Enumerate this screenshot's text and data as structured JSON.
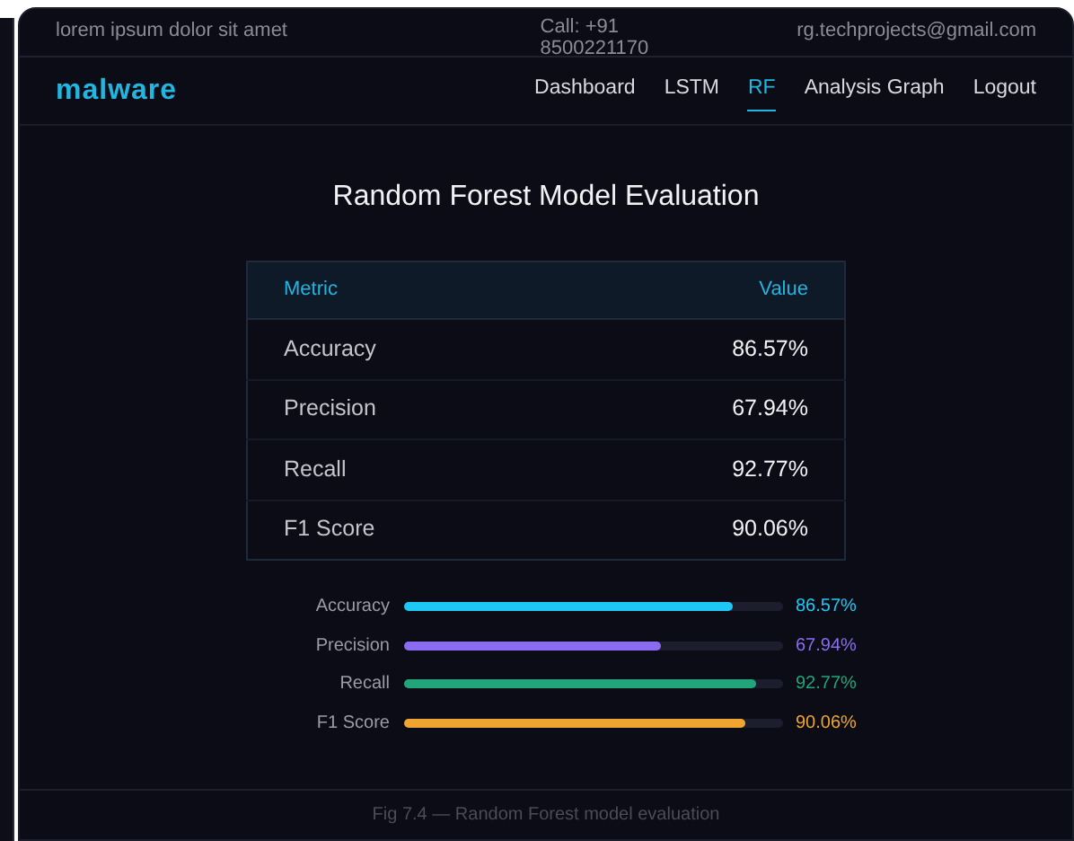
{
  "topbar": {
    "tagline": "lorem ipsum dolor sit amet",
    "phone": "Call: +91 8500221170",
    "email": "rg.techprojects@gmail.com"
  },
  "navbar": {
    "brand": "malware",
    "links": [
      {
        "label": "Dashboard",
        "selected": false
      },
      {
        "label": "LSTM",
        "selected": false
      },
      {
        "label": "RF",
        "selected": true
      },
      {
        "label": "Analysis Graph",
        "selected": false
      },
      {
        "label": "Logout",
        "selected": false
      }
    ]
  },
  "title": "Random Forest Model Evaluation",
  "table": {
    "columns": [
      "Metric",
      "Value"
    ],
    "rows": [
      [
        "Accuracy",
        "86.57%"
      ],
      [
        "Precision",
        "67.94%"
      ],
      [
        "Recall",
        "92.77%"
      ],
      [
        "F1 Score",
        "90.06%"
      ]
    ]
  },
  "meters": [
    {
      "label": "Accuracy",
      "level": 0.8657,
      "reading": "86.57%",
      "color": "#1ec8f5"
    },
    {
      "label": "Precision",
      "level": 0.6794,
      "reading": "67.94%",
      "color": "#8b6cf0"
    },
    {
      "label": "Recall",
      "level": 0.9277,
      "reading": "92.77%",
      "color": "#22a57a"
    },
    {
      "label": "F1 Score",
      "level": 0.9006,
      "reading": "90.06%",
      "color": "#f0a530"
    }
  ],
  "caption": "Fig 7.4 — Random Forest model evaluation"
}
